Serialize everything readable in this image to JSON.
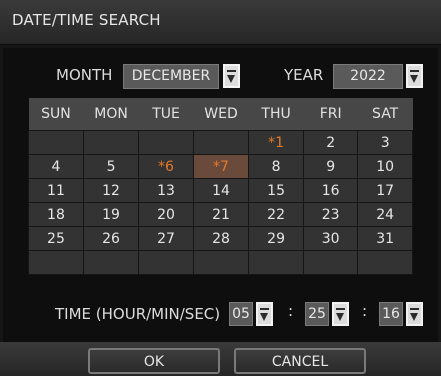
{
  "dialog": {
    "title": "DATE/TIME SEARCH"
  },
  "month": {
    "label": "MONTH",
    "value": "DECEMBER"
  },
  "year": {
    "label": "YEAR",
    "value": "2022"
  },
  "calendar": {
    "weekdays": [
      "SUN",
      "MON",
      "TUE",
      "WED",
      "THU",
      "FRI",
      "SAT"
    ],
    "weeks": [
      [
        "",
        "",
        "",
        "",
        "*1",
        "2",
        "3"
      ],
      [
        "4",
        "5",
        "*6",
        "*7",
        "8",
        "9",
        "10"
      ],
      [
        "11",
        "12",
        "13",
        "14",
        "15",
        "16",
        "17"
      ],
      [
        "18",
        "19",
        "20",
        "21",
        "22",
        "23",
        "24"
      ],
      [
        "25",
        "26",
        "27",
        "28",
        "29",
        "30",
        "31"
      ],
      [
        "",
        "",
        "",
        "",
        "",
        "",
        ""
      ]
    ],
    "recording_days": [
      "*1",
      "*6",
      "*7"
    ],
    "selected_day": "*7",
    "colors": {
      "recording": "#e8782a",
      "selected_bg": "#6a4a3a"
    }
  },
  "time": {
    "label": "TIME (HOUR/MIN/SEC)",
    "hour": "05",
    "minute": "25",
    "second": "16",
    "separator": ":"
  },
  "buttons": {
    "ok": "OK",
    "cancel": "CANCEL"
  }
}
